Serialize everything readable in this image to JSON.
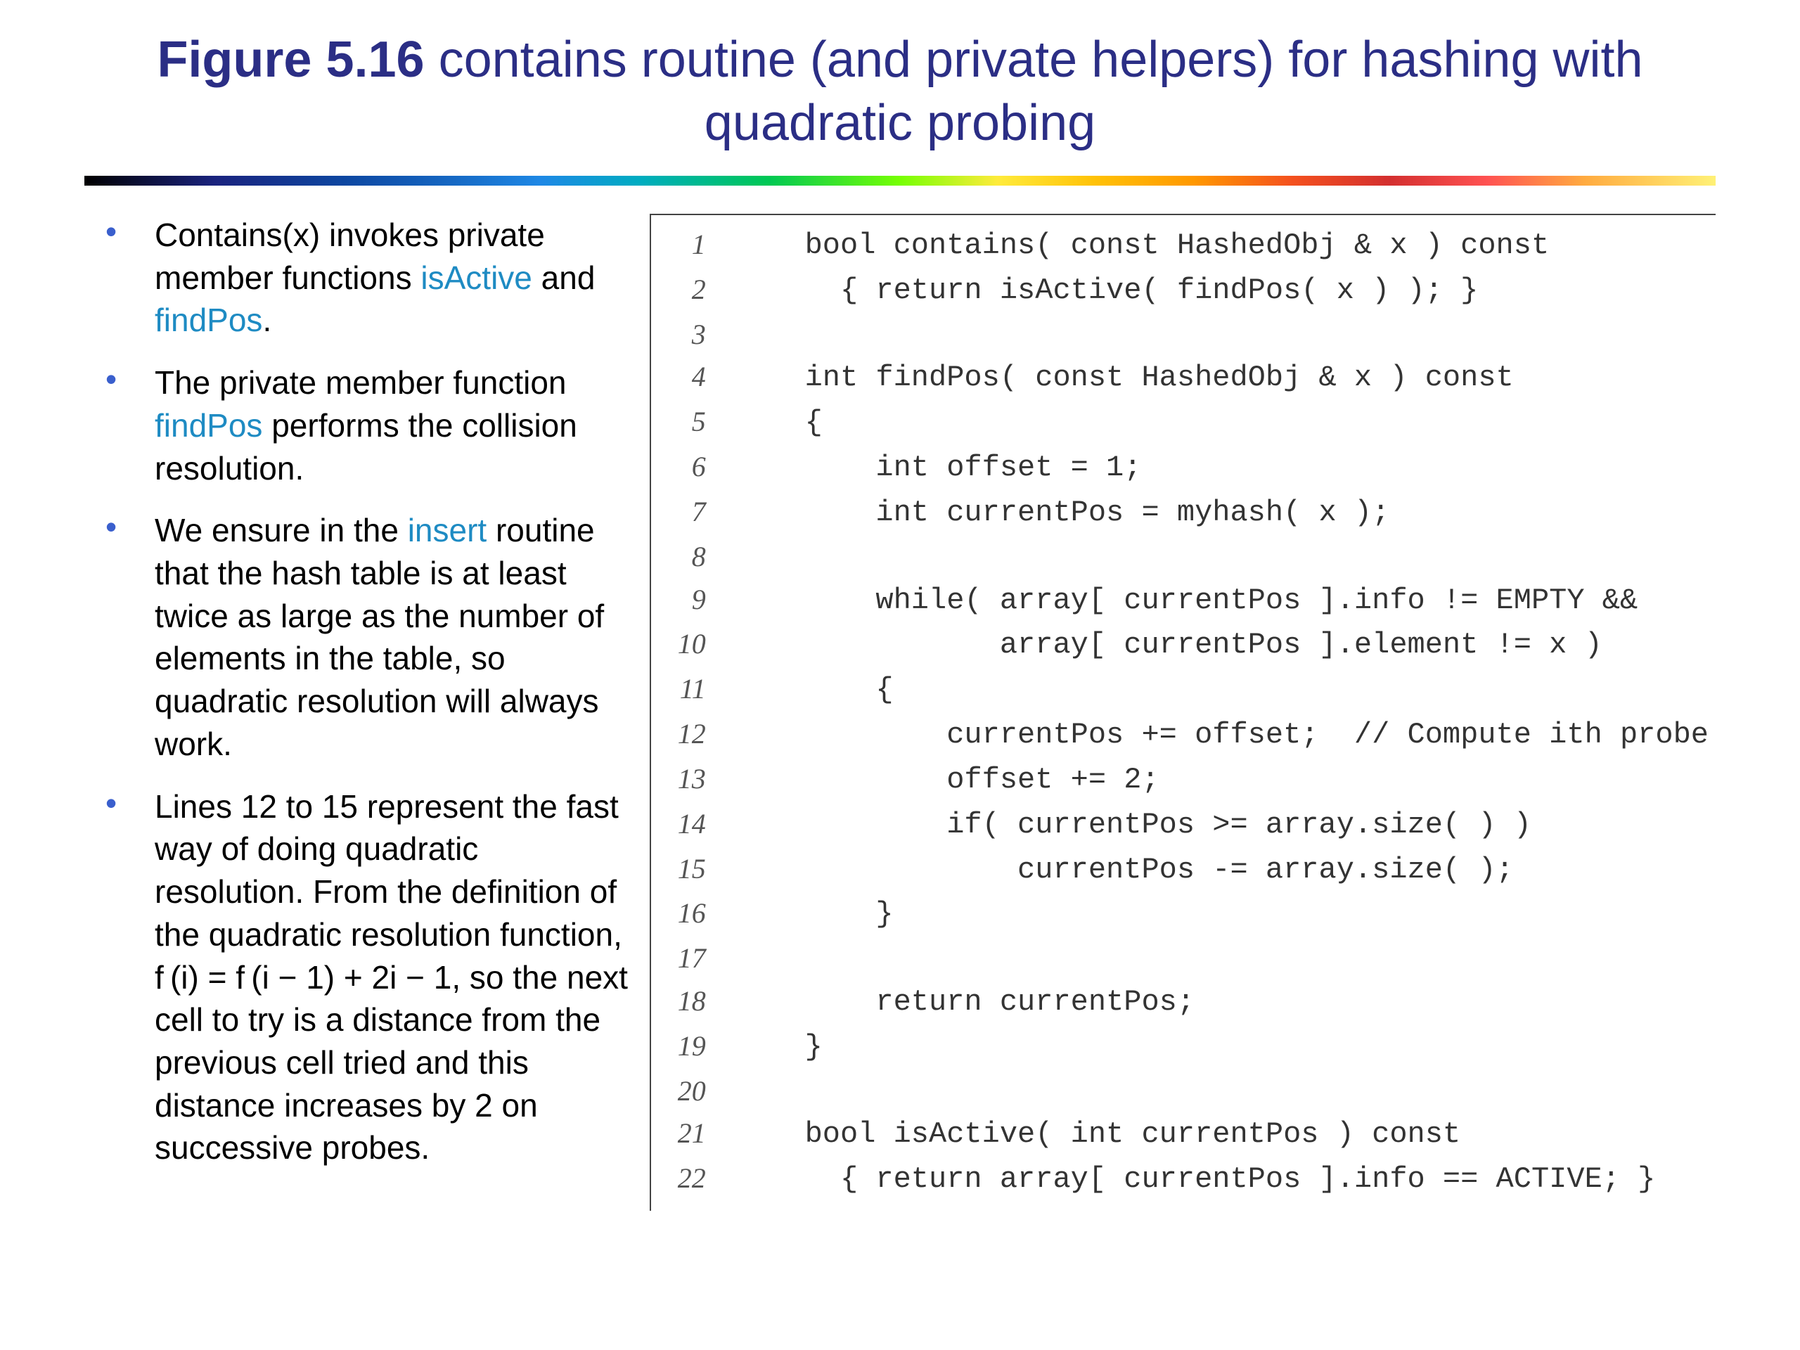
{
  "title": {
    "figref": "Figure 5.16",
    "rest": " contains routine (and private helpers) for hashing with quadratic probing"
  },
  "bullets": [
    {
      "segments": [
        {
          "t": "Contains(x) invokes private member functions "
        },
        {
          "t": "isActive",
          "kw": true
        },
        {
          "t": " and "
        },
        {
          "t": "findPos",
          "kw": true
        },
        {
          "t": "."
        }
      ]
    },
    {
      "segments": [
        {
          "t": "The private member function "
        },
        {
          "t": "findPos",
          "kw": true
        },
        {
          "t": " performs the collision resolution."
        }
      ]
    },
    {
      "segments": [
        {
          "t": "We ensure in the "
        },
        {
          "t": "insert",
          "kw": true
        },
        {
          "t": " routine that the hash table is at least twice as large as the number of elements in the table, so quadratic resolution will always work."
        }
      ]
    },
    {
      "segments": [
        {
          "t": "Lines 12 to 15 represent the fast way of doing quadratic resolution. From the definition of the quadratic resolution function, f (i) = f (i − 1) + 2i − 1, so the next cell to try is a distance from the previous cell tried and this distance increases by 2 on successive probes."
        }
      ]
    }
  ],
  "code": [
    {
      "n": 1,
      "t": "    bool contains( const HashedObj & x ) const"
    },
    {
      "n": 2,
      "t": "      { return isActive( findPos( x ) ); }"
    },
    {
      "n": 3,
      "t": ""
    },
    {
      "n": 4,
      "t": "    int findPos( const HashedObj & x ) const"
    },
    {
      "n": 5,
      "t": "    {"
    },
    {
      "n": 6,
      "t": "        int offset = 1;"
    },
    {
      "n": 7,
      "t": "        int currentPos = myhash( x );"
    },
    {
      "n": 8,
      "t": ""
    },
    {
      "n": 9,
      "t": "        while( array[ currentPos ].info != EMPTY &&"
    },
    {
      "n": 10,
      "t": "               array[ currentPos ].element != x )"
    },
    {
      "n": 11,
      "t": "        {"
    },
    {
      "n": 12,
      "t": "            currentPos += offset;  // Compute ith probe"
    },
    {
      "n": 13,
      "t": "            offset += 2;"
    },
    {
      "n": 14,
      "t": "            if( currentPos >= array.size( ) )"
    },
    {
      "n": 15,
      "t": "                currentPos -= array.size( );"
    },
    {
      "n": 16,
      "t": "        }"
    },
    {
      "n": 17,
      "t": ""
    },
    {
      "n": 18,
      "t": "        return currentPos;"
    },
    {
      "n": 19,
      "t": "    }"
    },
    {
      "n": 20,
      "t": ""
    },
    {
      "n": 21,
      "t": "    bool isActive( int currentPos ) const"
    },
    {
      "n": 22,
      "t": "      { return array[ currentPos ].info == ACTIVE; }"
    }
  ]
}
